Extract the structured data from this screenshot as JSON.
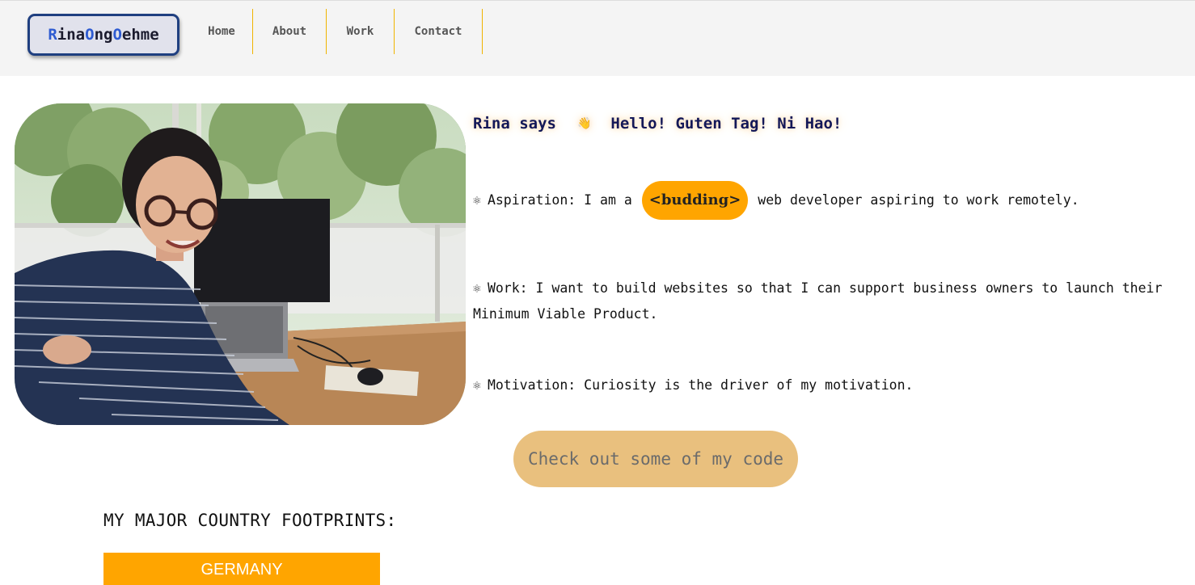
{
  "logo": {
    "parts": [
      {
        "text": "R",
        "cap": true
      },
      {
        "text": "ina",
        "cap": false
      },
      {
        "text": "O",
        "cap": true
      },
      {
        "text": "ng",
        "cap": false
      },
      {
        "text": "O",
        "cap": true
      },
      {
        "text": "ehme",
        "cap": false
      }
    ]
  },
  "nav": {
    "items": [
      "Home",
      "About",
      "Work",
      "Contact"
    ]
  },
  "intro": {
    "speaker": "Rina says",
    "wave": "👋",
    "greeting": "Hello! Guten Tag! Ni Hao!"
  },
  "bullets": {
    "icon": "⚛",
    "aspiration_pre": "Aspiration: I am a",
    "aspiration_badge": "<budding>",
    "aspiration_post": "web developer aspiring to work remotely.",
    "work_line1": "Work: I want to build websites so that I can support business owners to launch their",
    "work_line2": "Minimum Viable Product.",
    "motivation": "Motivation: Curiosity is the driver of my motivation."
  },
  "cta_label": "Check out some of my code",
  "footprints": {
    "title": "MY MAJOR COUNTRY FOOTPRINTS:",
    "countries": [
      "GERMANY"
    ]
  },
  "colors": {
    "accent": "#ffa500",
    "cta": "#e9c07e",
    "navy": "#131858",
    "logo_border": "#1f3f80"
  },
  "photo": {
    "alt": "Rina smiling at her desk with a monitor and laptop, trees visible through the window"
  }
}
